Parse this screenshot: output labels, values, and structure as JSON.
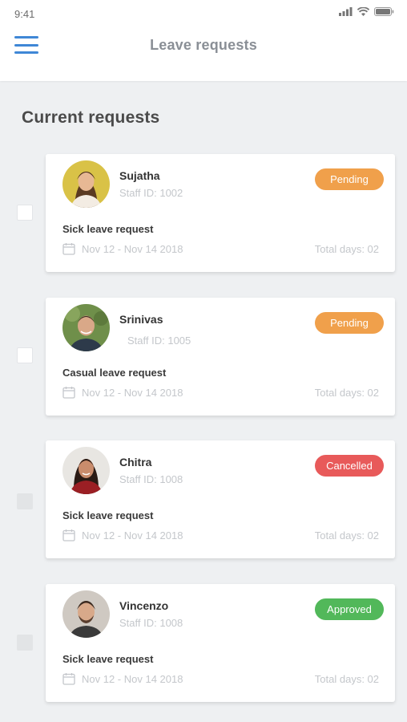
{
  "status_bar": {
    "time": "9:41"
  },
  "header": {
    "title": "Leave requests",
    "menu_icon": "hamburger-menu-icon"
  },
  "section": {
    "title": "Current requests"
  },
  "colors": {
    "pending": "#f0a04b",
    "cancelled": "#e85a5a",
    "approved": "#52b85a",
    "menu_blue": "#3f87d6"
  },
  "requests": [
    {
      "name": "Sujatha",
      "staff_id": "Staff ID: 1002",
      "status": "Pending",
      "status_color": "#f0a04b",
      "type": "Sick leave request",
      "dates": "Nov 12 - Nov 14 2018",
      "total_days": "Total days: 02"
    },
    {
      "name": "Srinivas",
      "staff_id": "Staff ID: 1005",
      "status": "Pending",
      "status_color": "#f0a04b",
      "type": "Casual leave request",
      "dates": "Nov 12 - Nov 14 2018",
      "total_days": "Total days: 02"
    },
    {
      "name": "Chitra",
      "staff_id": "Staff ID: 1008",
      "status": "Cancelled",
      "status_color": "#e85a5a",
      "type": "Sick leave request",
      "dates": "Nov 12 - Nov 14 2018",
      "total_days": "Total days: 02"
    },
    {
      "name": "Vincenzo",
      "staff_id": "Staff ID: 1008",
      "status": "Approved",
      "status_color": "#52b85a",
      "type": "Sick leave request",
      "dates": "Nov 12 - Nov 14 2018",
      "total_days": "Total days: 02"
    }
  ]
}
